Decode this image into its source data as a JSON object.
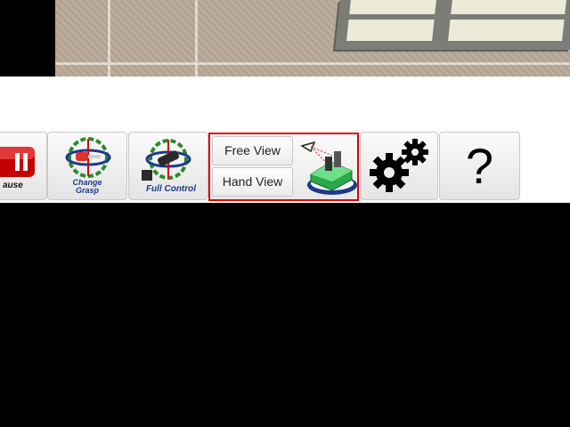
{
  "toolbar": {
    "pause_label": "ause",
    "change_grasp_line1": "Change",
    "change_grasp_line2": "Grasp",
    "full_control_label": "Full Control",
    "free_view_label": "Free View",
    "hand_view_label": "Hand View",
    "help_label": "?"
  },
  "icons": {
    "pause": "pause-icon",
    "change_grasp": "change-grasp-icon",
    "full_control": "full-control-icon",
    "camera_view": "robot-camera-icon",
    "settings": "gears-icon"
  },
  "colors": {
    "selection_border": "#e00000",
    "caption_blue": "#1d3a8a"
  }
}
